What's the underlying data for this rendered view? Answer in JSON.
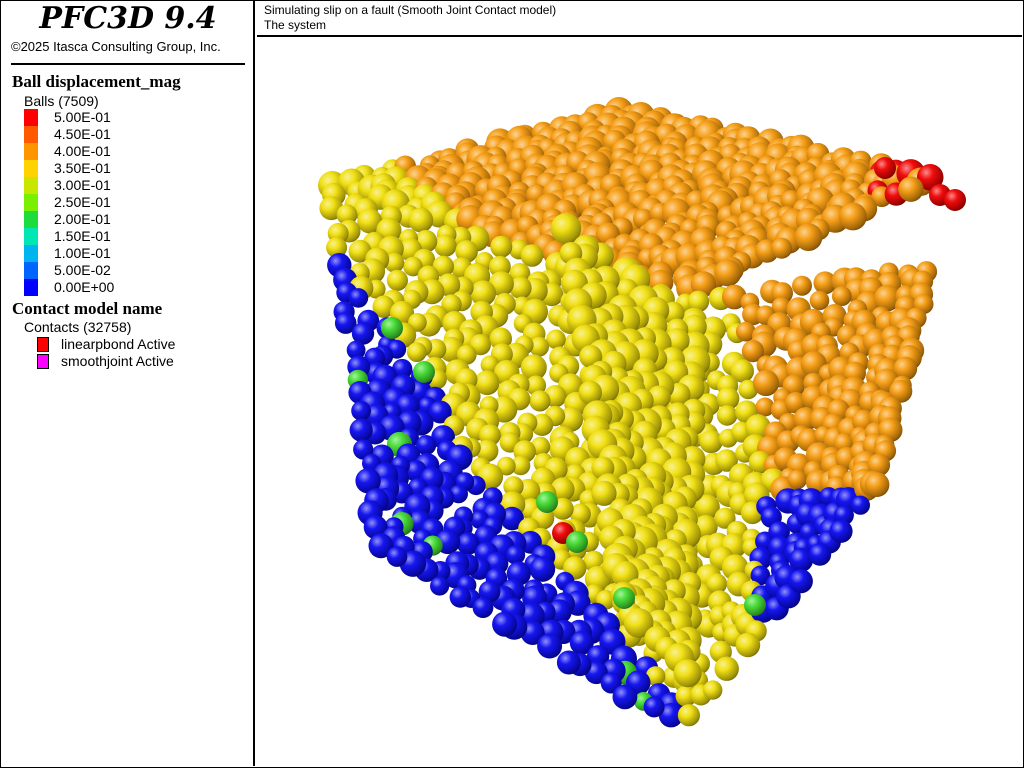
{
  "app": {
    "title": "PFC3D 9.4",
    "copyright": "©2025 Itasca Consulting Group, Inc."
  },
  "plot": {
    "title_line1": "Simulating slip on a fault (Smooth Joint Contact model)",
    "title_line2": "The system"
  },
  "ball_legend": {
    "title": "Ball displacement_mag",
    "count_label": "Balls (7509)",
    "scale": [
      {
        "label": "5.00E-01",
        "color": "#ff0000"
      },
      {
        "label": "4.50E-01",
        "color": "#ff5a00"
      },
      {
        "label": "4.00E-01",
        "color": "#ff9600"
      },
      {
        "label": "3.50E-01",
        "color": "#ffd200"
      },
      {
        "label": "3.00E-01",
        "color": "#c8e600"
      },
      {
        "label": "2.50E-01",
        "color": "#78f000"
      },
      {
        "label": "2.00E-01",
        "color": "#1edc3c"
      },
      {
        "label": "1.50E-01",
        "color": "#00e6b4"
      },
      {
        "label": "1.00E-01",
        "color": "#00b4f0"
      },
      {
        "label": "5.00E-02",
        "color": "#0064ff"
      },
      {
        "label": "0.00E+00",
        "color": "#0000ff"
      }
    ]
  },
  "contact_legend": {
    "title": "Contact model name",
    "count_label": "Contacts (32758)",
    "items": [
      {
        "label": "linearpbond Active",
        "color": "#ff0000"
      },
      {
        "label": "smoothjoint Active",
        "color": "#ff00ff"
      }
    ]
  },
  "scene": {
    "colors": {
      "blue": "#0a0af0",
      "yellow": "#f0de0a",
      "orange": "#f59a0c",
      "red": "#f00000",
      "green": "#40dc30"
    }
  }
}
